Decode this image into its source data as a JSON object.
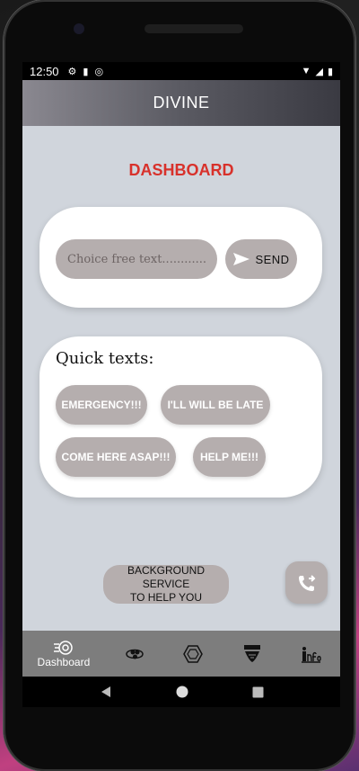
{
  "status_bar": {
    "time": "12:50"
  },
  "app_bar": {
    "title": "DIVINE"
  },
  "dashboard": {
    "heading": "DASHBOARD"
  },
  "message_card": {
    "input_placeholder": "Choice free text............",
    "send_label": "SEND"
  },
  "quick_texts": {
    "label": "Quick texts:",
    "chips": [
      "EMERGENCY!!!",
      "I'LL WILL BE LATE",
      "COME HERE ASAP!!!",
      "HELP ME!!!"
    ]
  },
  "background_service": {
    "label_line1": "BACKGROUND SERVICE",
    "label_line2": "TO HELP YOU"
  },
  "bottom_nav": {
    "items": [
      {
        "label": "Dashboard",
        "icon": "dashboard-icon",
        "active": true
      },
      {
        "label": "",
        "icon": "friends-icon"
      },
      {
        "label": "",
        "icon": "hexagon-icon"
      },
      {
        "label": "",
        "icon": "help-me-icon",
        "icon_text": "HELP ME"
      },
      {
        "label": "",
        "icon": "info-icon",
        "icon_text": "Info"
      }
    ]
  },
  "colors": {
    "accent_red": "#d8312b",
    "chip_gray": "#b5aeae",
    "screen_bg": "#d0d5dc",
    "nav_bg": "#7d7d7d"
  }
}
